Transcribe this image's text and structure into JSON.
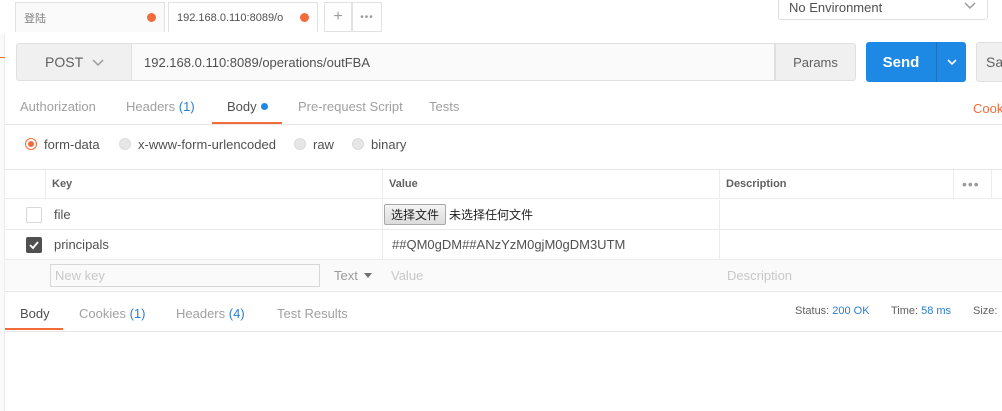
{
  "tabs": [
    {
      "label": "登陆",
      "active": false,
      "unsaved": true
    },
    {
      "label": "192.168.0.110:8089/o",
      "active": true,
      "unsaved": true
    }
  ],
  "tab_actions": {
    "add": "+",
    "more": "•••"
  },
  "environment": {
    "selected": "No Environment"
  },
  "request": {
    "method": "POST",
    "url": "192.168.0.110:8089/operations/outFBA",
    "params_label": "Params",
    "send_label": "Send",
    "save_label": "Sa"
  },
  "request_tabs": [
    {
      "label": "Authorization"
    },
    {
      "label": "Headers",
      "count": "(1)"
    },
    {
      "label": "Body",
      "active": true
    },
    {
      "label": "Pre-request Script"
    },
    {
      "label": "Tests"
    }
  ],
  "cookies_link": "Cook",
  "body_types": [
    {
      "label": "form-data",
      "selected": true
    },
    {
      "label": "x-www-form-urlencoded",
      "selected": false
    },
    {
      "label": "raw",
      "selected": false
    },
    {
      "label": "binary",
      "selected": false
    }
  ],
  "table": {
    "headers": {
      "key": "Key",
      "value": "Value",
      "description": "Description",
      "more": "•••"
    },
    "rows": [
      {
        "checked": false,
        "key": "file",
        "type": "file",
        "file_button": "选择文件",
        "file_status": "未选择任何文件",
        "description": ""
      },
      {
        "checked": true,
        "key": "principals",
        "type": "text",
        "value": "##QM0gDM##ANzYzM0gjM0gDM3UTM",
        "description": ""
      }
    ],
    "new_row": {
      "key_placeholder": "New key",
      "type_label": "Text",
      "value_placeholder": "Value",
      "description_placeholder": "Description"
    }
  },
  "response": {
    "tabs": [
      {
        "label": "Body",
        "active": true
      },
      {
        "label": "Cookies",
        "count": "(1)"
      },
      {
        "label": "Headers",
        "count": "(4)"
      },
      {
        "label": "Test Results"
      }
    ],
    "status_label": "Status:",
    "status_value": "200 OK",
    "time_label": "Time:",
    "time_value": "58 ms",
    "size_label": "Size:"
  },
  "colors": {
    "accent": "#f26b3a",
    "primary": "#1e88e5",
    "link": "#2a7dd4"
  }
}
